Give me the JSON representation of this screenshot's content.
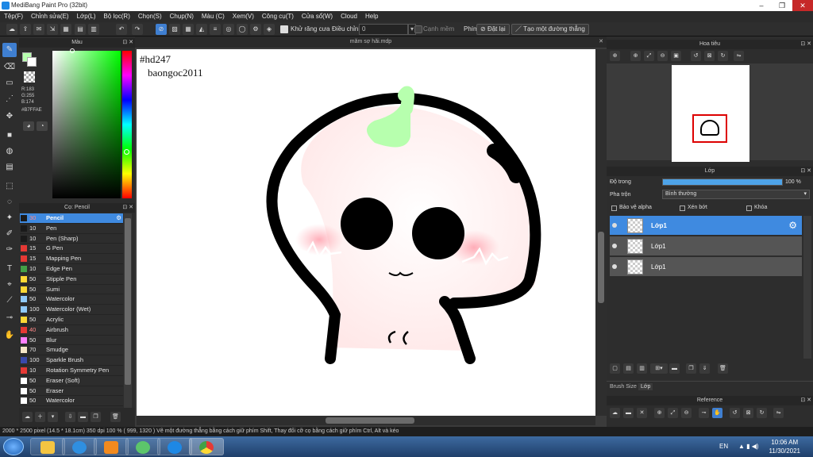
{
  "app": {
    "title": "MediBang Paint Pro (32bit)"
  },
  "menu": [
    "Tệp(F)",
    "Chỉnh sửa(E)",
    "Lớp(L)",
    "Bộ lọc(R)",
    "Chọn(S)",
    "Chụp(N)",
    "Màu (C)",
    "Xem(V)",
    "Công cụ(T)",
    "Cửa sổ(W)",
    "Cloud",
    "Help"
  ],
  "toolbar": {
    "antialias_label": "Khử răng cưa",
    "adjust_label": "Điều chỉnh",
    "adjust_value": "0",
    "edge_label": "Cạnh mềm",
    "key_label": "Phím",
    "reset_label": "Đặt lại",
    "straight_label": "Tạo một đường thẳng"
  },
  "color_panel": {
    "title": "Màu",
    "r": "R:183",
    "g": "G:255",
    "b": "B:174",
    "hex": "#B7FFAE",
    "fg": "#b7ffae"
  },
  "brush_panel": {
    "title": "Cọ: Pencil",
    "brushes": [
      {
        "size": "30",
        "name": "Pencil",
        "color": "#1a1a1a",
        "sizecolor": "#ff8a8a"
      },
      {
        "size": "10",
        "name": "Pen",
        "color": "#1a1a1a",
        "sizecolor": ""
      },
      {
        "size": "10",
        "name": "Pen (Sharp)",
        "color": "#1a1a1a",
        "sizecolor": ""
      },
      {
        "size": "15",
        "name": "G Pen",
        "color": "#e53935",
        "sizecolor": ""
      },
      {
        "size": "15",
        "name": "Mapping Pen",
        "color": "#e53935",
        "sizecolor": ""
      },
      {
        "size": "10",
        "name": "Edge Pen",
        "color": "#43a047",
        "sizecolor": ""
      },
      {
        "size": "50",
        "name": "Stipple Pen",
        "color": "#fdd835",
        "sizecolor": ""
      },
      {
        "size": "50",
        "name": "Sumi",
        "color": "#fdd835",
        "sizecolor": ""
      },
      {
        "size": "50",
        "name": "Watercolor",
        "color": "#90caf9",
        "sizecolor": ""
      },
      {
        "size": "100",
        "name": "Watercolor (Wet)",
        "color": "#90caf9",
        "sizecolor": ""
      },
      {
        "size": "50",
        "name": "Acrylic",
        "color": "#fdd835",
        "sizecolor": ""
      },
      {
        "size": "40",
        "name": "Airbrush",
        "color": "#e53935",
        "sizecolor": "#ff8a8a"
      },
      {
        "size": "50",
        "name": "Blur",
        "color": "#ff80ff",
        "sizecolor": ""
      },
      {
        "size": "70",
        "name": "Smudge",
        "color": "#f5e6c8",
        "sizecolor": ""
      },
      {
        "size": "100",
        "name": "Sparkle Brush",
        "color": "#3949ab",
        "sizecolor": ""
      },
      {
        "size": "10",
        "name": "Rotation Symmetry Pen",
        "color": "#e53935",
        "sizecolor": ""
      },
      {
        "size": "50",
        "name": "Eraser (Soft)",
        "color": "#ffffff",
        "sizecolor": ""
      },
      {
        "size": "50",
        "name": "Eraser",
        "color": "#ffffff",
        "sizecolor": ""
      },
      {
        "size": "50",
        "name": "Watercolor",
        "color": "#ffffff",
        "sizecolor": ""
      }
    ]
  },
  "canvas": {
    "doc_name": "măm sợ hãi.mdp",
    "text1": "#hd247",
    "text2": "baongoc2011"
  },
  "navigator": {
    "title": "Hoa tiêu"
  },
  "layer_panel": {
    "title": "Lớp",
    "opacity_label": "Độ trong",
    "opacity_value": "100 %",
    "opacity": 1.0,
    "blend_label": "Pha trộn",
    "blend_value": "Bình thường",
    "protect_alpha": "Bảo vệ alpha",
    "clipping": "Xén bớt",
    "lock": "Khóa",
    "layers": [
      {
        "name": "Lớp1"
      },
      {
        "name": "Lớp1"
      },
      {
        "name": "Lớp1"
      }
    ],
    "brush_size_tab": "Brush Size",
    "layer_tab": "Lớp"
  },
  "reference": {
    "title": "Reference"
  },
  "status": {
    "text": "2000 * 2500 pixel   (14.5 * 18.1cm)   350 dpi   100 %   ( 999, 1320 )   Vẽ một đường thẳng bằng cách giữ phím Shift, Thay đổi cỡ cọ bằng cách giữ phím Ctrl, Alt và kéo"
  },
  "taskbar": {
    "lang": "EN",
    "time": "10:06 AM",
    "date": "11/30/2021"
  }
}
